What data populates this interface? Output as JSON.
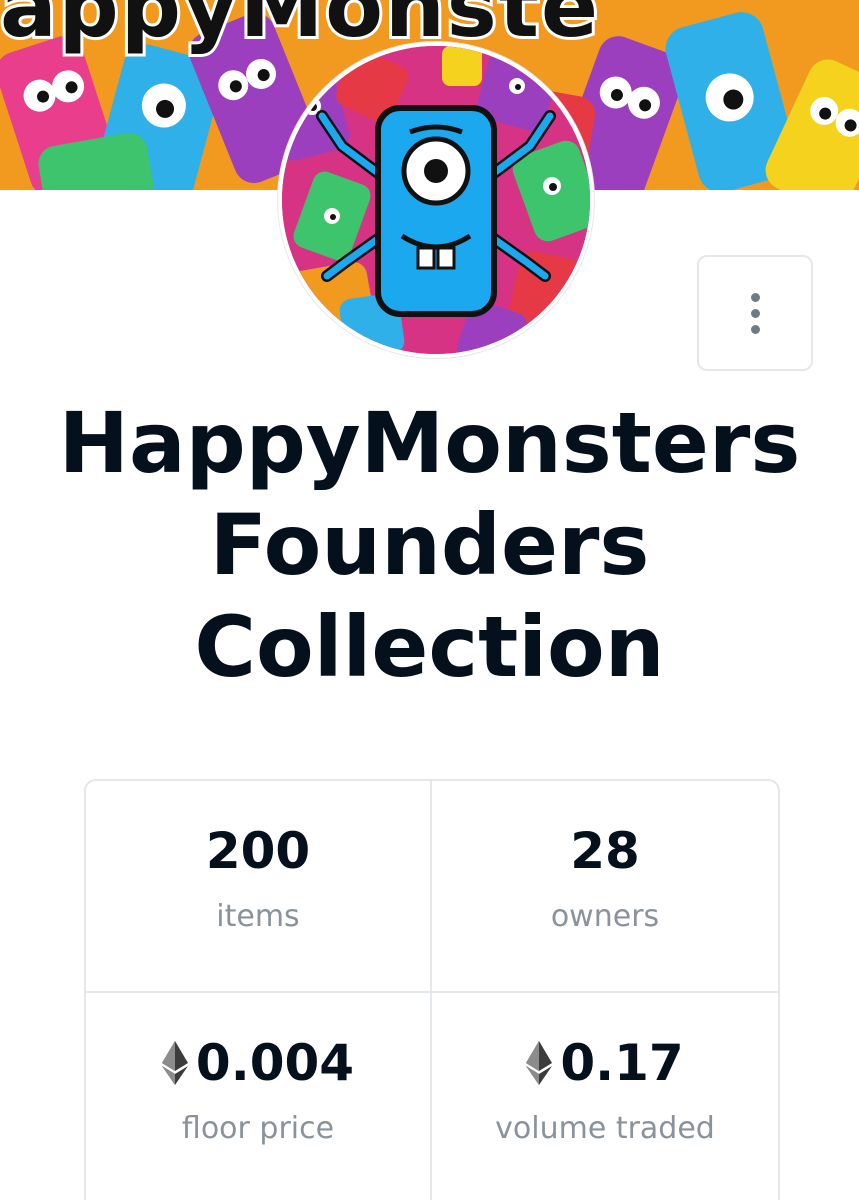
{
  "banner": {
    "title_fragment": "appyMonste"
  },
  "collection": {
    "title_line1": "HappyMonsters",
    "title_line2": "Founders",
    "title_line3": "Collection"
  },
  "stats": {
    "items": {
      "value": "200",
      "label": "items"
    },
    "owners": {
      "value": "28",
      "label": "owners"
    },
    "floor_price": {
      "value": "0.004",
      "label": "floor price",
      "icon": "ethereum-icon"
    },
    "volume_traded": {
      "value": "0.17",
      "label": "volume traded",
      "icon": "ethereum-icon"
    }
  },
  "colors": {
    "text_primary": "#04111d",
    "text_secondary": "#8a939b",
    "border": "#e5e8eb",
    "monster_blue": "#1ba8ef"
  }
}
